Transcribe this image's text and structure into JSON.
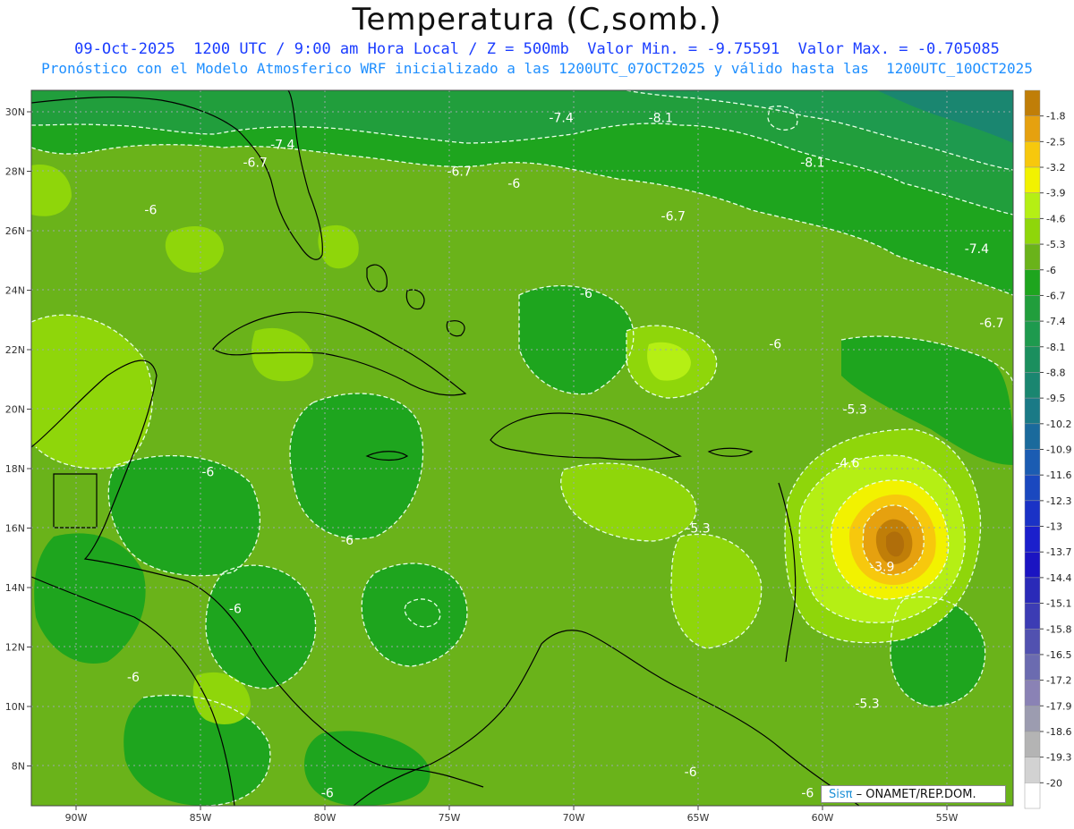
{
  "header": {
    "title": "Temperatura (C,somb.)",
    "line1": "09-Oct-2025  1200 UTC / 9:00 am Hora Local / Z = 500mb  Valor Min. = -9.75591  Valor Max. = -0.705085",
    "line2": "Pronóstico con el Modelo Atmosferico WRF inicializado a las 1200UTC_07OCT2025 y válido hasta las  1200UTC_10OCT2025"
  },
  "map": {
    "lat_ticks": [
      "30N",
      "28N",
      "26N",
      "24N",
      "22N",
      "20N",
      "18N",
      "16N",
      "14N",
      "12N",
      "10N",
      "8N"
    ],
    "lon_ticks": [
      "90W",
      "85W",
      "80W",
      "75W",
      "70W",
      "65W",
      "60W",
      "55W"
    ],
    "contour_labels": [
      {
        "text": "-7.4",
        "lon": -70.5,
        "lat": 29.8
      },
      {
        "text": "-8.1",
        "lon": -66.5,
        "lat": 29.8
      },
      {
        "text": "-7.4",
        "lon": -81.7,
        "lat": 28.9
      },
      {
        "text": "-6.7",
        "lon": -82.8,
        "lat": 28.3
      },
      {
        "text": "-6.7",
        "lon": -74.6,
        "lat": 28.0
      },
      {
        "text": "-6",
        "lon": -72.4,
        "lat": 27.6
      },
      {
        "text": "-8.1",
        "lon": -60.4,
        "lat": 28.3
      },
      {
        "text": "-6",
        "lon": -87.0,
        "lat": 26.7
      },
      {
        "text": "-6.7",
        "lon": -66.0,
        "lat": 26.5
      },
      {
        "text": "-7.4",
        "lon": -53.8,
        "lat": 25.4
      },
      {
        "text": "-6",
        "lon": -69.5,
        "lat": 23.9
      },
      {
        "text": "-6.7",
        "lon": -53.2,
        "lat": 22.9
      },
      {
        "text": "-6",
        "lon": -61.9,
        "lat": 22.2
      },
      {
        "text": "-5.3",
        "lon": -58.7,
        "lat": 20.0
      },
      {
        "text": "-4.6",
        "lon": -59.0,
        "lat": 18.2
      },
      {
        "text": "-6",
        "lon": -84.7,
        "lat": 17.9
      },
      {
        "text": "-5.3",
        "lon": -65.0,
        "lat": 16.0
      },
      {
        "text": "-6",
        "lon": -79.1,
        "lat": 15.6
      },
      {
        "text": "-3.9",
        "lon": -57.6,
        "lat": 14.7
      },
      {
        "text": "-6",
        "lon": -83.6,
        "lat": 13.3
      },
      {
        "text": "-6",
        "lon": -87.7,
        "lat": 11.0
      },
      {
        "text": "-5.3",
        "lon": -58.2,
        "lat": 10.1
      },
      {
        "text": "-6",
        "lon": -65.3,
        "lat": 7.8
      },
      {
        "text": "-6",
        "lon": -79.9,
        "lat": 7.1
      },
      {
        "text": "-6",
        "lon": -60.6,
        "lat": 7.1
      }
    ],
    "credit_brand": "Sisπ",
    "credit_rest": " – ONAMET/REP.DOM."
  },
  "colorbar": {
    "labels": [
      "-1.8",
      "-2.5",
      "-3.2",
      "-3.9",
      "-4.6",
      "-5.3",
      "-6",
      "-6.7",
      "-7.4",
      "-8.1",
      "-8.8",
      "-9.5",
      "-10.2",
      "-10.9",
      "-11.6",
      "-12.3",
      "-13",
      "-13.7",
      "-14.4",
      "-15.1",
      "-15.8",
      "-16.5",
      "-17.2",
      "-17.9",
      "-18.6",
      "-19.3",
      "-20"
    ],
    "colors": [
      "#c07e08",
      "#e6a10f",
      "#f7c80d",
      "#f2f200",
      "#b5ef14",
      "#8fd60a",
      "#6ab31a",
      "#1ea51e",
      "#219e3c",
      "#1e9a4e",
      "#1b8f5e",
      "#1a8670",
      "#1a7a86",
      "#1a6a9c",
      "#1b5cb2",
      "#1a48bf",
      "#1a32c6",
      "#1b1fcc",
      "#1b14c2",
      "#2a2ab8",
      "#3c3cb4",
      "#5151b0",
      "#6b6bb0",
      "#8a82b5",
      "#9c9cb0",
      "#b4b4b4",
      "#d2d2d2",
      "#ffffff"
    ]
  }
}
